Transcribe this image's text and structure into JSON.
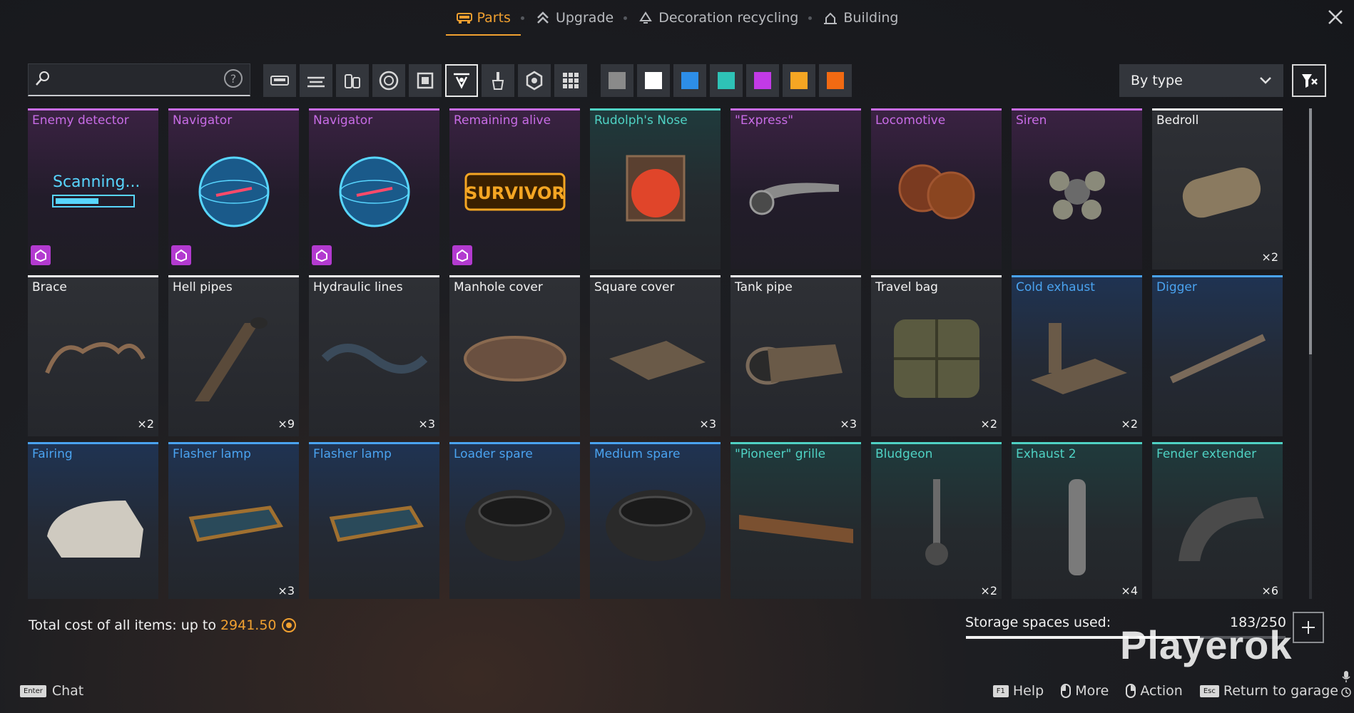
{
  "tabs": [
    {
      "label": "Parts",
      "icon": "parts-icon",
      "active": true
    },
    {
      "label": "Upgrade",
      "icon": "upgrade-icon",
      "active": false
    },
    {
      "label": "Decoration recycling",
      "icon": "recycle-icon",
      "active": false
    },
    {
      "label": "Building",
      "icon": "building-icon",
      "active": false
    }
  ],
  "search": {
    "value": "",
    "placeholder": ""
  },
  "categories": [
    "cabin-icon",
    "frames-icon",
    "tanks-icon",
    "wheels-icon",
    "armor-icon",
    "decor-icon",
    "paint-icon",
    "gear-icon",
    "all-grid-icon"
  ],
  "selected_category": 5,
  "color_filters": [
    "#8a8a8a",
    "#ffffff",
    "#2d8ee8",
    "#2ec2b6",
    "#c23ae6",
    "#f5a623",
    "#f26a12"
  ],
  "sort": {
    "label": "By type"
  },
  "items": [
    {
      "name": "Enemy detector",
      "rarity": "purple",
      "color": "#c86ce6",
      "qty": "",
      "badge": true
    },
    {
      "name": "Navigator",
      "rarity": "purple",
      "color": "#c86ce6",
      "qty": "",
      "badge": true
    },
    {
      "name": "Navigator",
      "rarity": "purple",
      "color": "#c86ce6",
      "qty": "",
      "badge": true
    },
    {
      "name": "Remaining alive",
      "rarity": "purple",
      "color": "#c86ce6",
      "qty": "",
      "badge": true
    },
    {
      "name": "Rudolph's Nose",
      "rarity": "cyan",
      "color": "#4fd2c4",
      "qty": "",
      "badge": false
    },
    {
      "name": "\"Express\"",
      "rarity": "purple",
      "color": "#c86ce6",
      "qty": "",
      "badge": false
    },
    {
      "name": "Locomotive",
      "rarity": "purple",
      "color": "#c86ce6",
      "qty": "",
      "badge": false
    },
    {
      "name": "Siren",
      "rarity": "purple",
      "color": "#c86ce6",
      "qty": "",
      "badge": false
    },
    {
      "name": "Bedroll",
      "rarity": "white",
      "color": "#f2f2f2",
      "qty": "×2",
      "badge": false
    },
    {
      "name": "Brace",
      "rarity": "white",
      "color": "#f2f2f2",
      "qty": "×2",
      "badge": false
    },
    {
      "name": "Hell pipes",
      "rarity": "white",
      "color": "#f2f2f2",
      "qty": "×9",
      "badge": false
    },
    {
      "name": "Hydraulic lines",
      "rarity": "white",
      "color": "#f2f2f2",
      "qty": "×3",
      "badge": false
    },
    {
      "name": "Manhole cover",
      "rarity": "white",
      "color": "#f2f2f2",
      "qty": "",
      "badge": false
    },
    {
      "name": "Square cover",
      "rarity": "white",
      "color": "#f2f2f2",
      "qty": "×3",
      "badge": false
    },
    {
      "name": "Tank pipe",
      "rarity": "white",
      "color": "#f2f2f2",
      "qty": "×3",
      "badge": false
    },
    {
      "name": "Travel bag",
      "rarity": "white",
      "color": "#f2f2f2",
      "qty": "×2",
      "badge": false
    },
    {
      "name": "Cold exhaust",
      "rarity": "blue",
      "color": "#4aa3f0",
      "qty": "×2",
      "badge": false
    },
    {
      "name": "Digger",
      "rarity": "blue",
      "color": "#4aa3f0",
      "qty": "",
      "badge": false
    },
    {
      "name": "Fairing",
      "rarity": "blue",
      "color": "#4aa3f0",
      "qty": "",
      "badge": false
    },
    {
      "name": "Flasher lamp",
      "rarity": "blue",
      "color": "#4aa3f0",
      "qty": "×3",
      "badge": false
    },
    {
      "name": "Flasher lamp",
      "rarity": "blue",
      "color": "#4aa3f0",
      "qty": "",
      "badge": false
    },
    {
      "name": "Loader spare",
      "rarity": "blue",
      "color": "#4aa3f0",
      "qty": "",
      "badge": false
    },
    {
      "name": "Medium spare",
      "rarity": "blue",
      "color": "#4aa3f0",
      "qty": "",
      "badge": false
    },
    {
      "name": "\"Pioneer\" grille",
      "rarity": "cyan",
      "color": "#4fd2c4",
      "qty": "",
      "badge": false
    },
    {
      "name": "Bludgeon",
      "rarity": "cyan",
      "color": "#4fd2c4",
      "qty": "×2",
      "badge": false
    },
    {
      "name": "Exhaust 2",
      "rarity": "cyan",
      "color": "#4fd2c4",
      "qty": "×4",
      "badge": false
    },
    {
      "name": "Fender extender",
      "rarity": "cyan",
      "color": "#4fd2c4",
      "qty": "×6",
      "badge": false
    }
  ],
  "footer": {
    "total_label": "Total cost of all items: up to",
    "total_value": "2941.50",
    "storage_label": "Storage spaces used:",
    "storage_count": "183/250",
    "storage_fraction": 0.732,
    "watermark": "Playerok"
  },
  "bottom": {
    "chat_key": "Enter",
    "chat_label": "Chat",
    "hints": [
      {
        "key": "F1",
        "label": "Help",
        "type": "key"
      },
      {
        "key": "",
        "label": "More",
        "type": "mouse-left"
      },
      {
        "key": "",
        "label": "Action",
        "type": "mouse-right"
      },
      {
        "key": "Esc",
        "label": "Return to garage",
        "type": "key"
      }
    ]
  }
}
